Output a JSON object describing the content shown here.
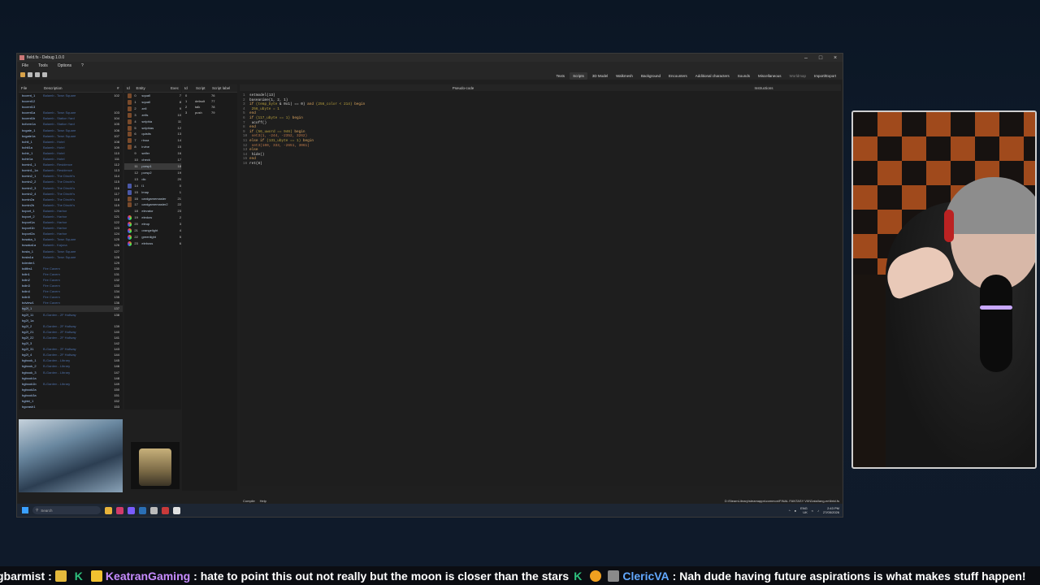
{
  "window": {
    "title": "field.fs - Debug 1.0.0",
    "menu": [
      "File",
      "Tools",
      "Options",
      "?"
    ],
    "controls": [
      "–",
      "□",
      "×"
    ]
  },
  "tabs": [
    {
      "label": "Texts",
      "active": false
    },
    {
      "label": "Scripts",
      "active": true
    },
    {
      "label": "3D Model",
      "active": false
    },
    {
      "label": "Walkmesh",
      "active": false
    },
    {
      "label": "Background",
      "active": false
    },
    {
      "label": "Encounters",
      "active": false
    },
    {
      "label": "Additional characters",
      "active": false
    },
    {
      "label": "Sounds",
      "active": false
    },
    {
      "label": "Miscellaneous",
      "active": false
    },
    {
      "label": "Worldmap",
      "active": false,
      "dim": true
    },
    {
      "label": "Import/Export",
      "active": false
    }
  ],
  "file_list": {
    "headers": [
      "File",
      "Description",
      "#"
    ],
    "rows": [
      [
        "bccent_1",
        "Balamb - Town Square",
        "102"
      ],
      [
        "bccent12",
        "",
        ""
      ],
      [
        "bccent13",
        "",
        ""
      ],
      [
        "bccent1a",
        "Balamb - Town Square",
        "103"
      ],
      [
        "bccent1b",
        "Balamb - Station Yard",
        "104"
      ],
      [
        "bcform1a",
        "Balamb - Station Yard",
        "105"
      ],
      [
        "bcgate_1",
        "Balamb - Town Square",
        "106"
      ],
      [
        "bcgate1a",
        "Balamb - Town Square",
        "107"
      ],
      [
        "bchtl_1",
        "Balamb - Hotel",
        "108"
      ],
      [
        "bchtl1a",
        "Balamb - Hotel",
        "109"
      ],
      [
        "bchtr_1",
        "Balamb - Hotel",
        "110"
      ],
      [
        "bchtr1a",
        "Balamb - Hotel",
        "111"
      ],
      [
        "bcmin1_1",
        "Balamb - Residence",
        "112"
      ],
      [
        "bcmin1_1a",
        "Balamb - Residence",
        "113"
      ],
      [
        "bcmin2_1",
        "Balamb - The Dincht's",
        "114"
      ],
      [
        "bcmin2_2",
        "Balamb - The Dincht's",
        "115"
      ],
      [
        "bcmin2_3",
        "Balamb - The Dincht's",
        "116"
      ],
      [
        "bcmin2_4",
        "Balamb - The Dincht's",
        "117"
      ],
      [
        "bcmin2a",
        "Balamb - The Dincht's",
        "118"
      ],
      [
        "bcmin2b",
        "Balamb - The Dincht's",
        "119"
      ],
      [
        "bcport_1",
        "Balamb - Harbor",
        "120"
      ],
      [
        "bcport_2",
        "Balamb - Harbor",
        "121"
      ],
      [
        "bcport1a",
        "Balamb - Harbor",
        "122"
      ],
      [
        "bcport1b",
        "Balamb - Harbor",
        "123"
      ],
      [
        "bcport2a",
        "Balamb - Harbor",
        "124"
      ],
      [
        "bcsaka_1",
        "Balamb - Town Square",
        "125"
      ],
      [
        "bcsaka1a",
        "Balamb - Kajona",
        "126"
      ],
      [
        "bcsta_1",
        "Balamb - Town Square",
        "127"
      ],
      [
        "bcsta1a",
        "Balamb - Town Square",
        "128"
      ],
      [
        "bdenter1",
        "",
        "129"
      ],
      [
        "bdifirs1",
        "Fire Cavern",
        "130"
      ],
      [
        "bdin1",
        "Fire Cavern",
        "131"
      ],
      [
        "bdin2",
        "Fire Cavern",
        "132"
      ],
      [
        "bdin3",
        "Fire Cavern",
        "133"
      ],
      [
        "bdin4",
        "Fire Cavern",
        "134"
      ],
      [
        "bdin5",
        "Fire Cavern",
        "135"
      ],
      [
        "bdview1",
        "Fire Cavern",
        "136"
      ],
      [
        "bg2f_1",
        "",
        "137"
      ],
      [
        "bg2f_11",
        "B-Garden - 2F Hallway",
        "138"
      ],
      [
        "bg2f_1a",
        "",
        ""
      ],
      [
        "bg2f_2",
        "B-Garden - 2F Hallway",
        "139"
      ],
      [
        "bg2f_21",
        "B-Garden - 2F Hallway",
        "140"
      ],
      [
        "bg2f_22",
        "B-Garden - 2F Hallway",
        "141"
      ],
      [
        "bg2f_3",
        "",
        "142"
      ],
      [
        "bg2f_31",
        "B-Garden - 2F Hallway",
        "143"
      ],
      [
        "bg2f_4",
        "B-Garden - 2F Hallway",
        "144"
      ],
      [
        "bgbook_1",
        "B-Garden - Library",
        "145"
      ],
      [
        "bgbook_2",
        "B-Garden - Library",
        "146"
      ],
      [
        "bgbook_3",
        "B-Garden - Library",
        "147"
      ],
      [
        "bgbook1a",
        "",
        "148"
      ],
      [
        "bgbook1b",
        "B-Garden - Library",
        "149"
      ],
      [
        "bgbook2a",
        "",
        "150"
      ],
      [
        "bgbook3a",
        "",
        "151"
      ],
      [
        "bgbkt_1",
        "",
        "152"
      ],
      [
        "bgcrash1",
        "",
        "153"
      ]
    ],
    "selected_index": 37
  },
  "entities": {
    "headers": [
      "Id",
      "Entity",
      "Exec"
    ],
    "rows": [
      {
        "id": "0",
        "name": "squall",
        "exec": "7",
        "icon": "char"
      },
      {
        "id": "1",
        "name": "squall",
        "exec": "8",
        "icon": "char"
      },
      {
        "id": "2",
        "name": "zell",
        "exec": "9",
        "icon": "char"
      },
      {
        "id": "3",
        "name": "zells",
        "exec": "10",
        "icon": "char"
      },
      {
        "id": "4",
        "name": "selphia",
        "exec": "11",
        "icon": "char"
      },
      {
        "id": "5",
        "name": "selphias",
        "exec": "12",
        "icon": "char"
      },
      {
        "id": "6",
        "name": "quistis",
        "exec": "13",
        "icon": "char"
      },
      {
        "id": "7",
        "name": "rinoa",
        "exec": "14",
        "icon": "char"
      },
      {
        "id": "8",
        "name": "irvine",
        "exec": "15",
        "icon": "char"
      },
      {
        "id": "9",
        "name": "seifer",
        "exec": "16",
        "icon": "none"
      },
      {
        "id": "10",
        "name": "check",
        "exec": "17",
        "icon": "none"
      },
      {
        "id": "11",
        "name": "porsp1",
        "exec": "18",
        "icon": "none"
      },
      {
        "id": "12",
        "name": "porsp2",
        "exec": "19",
        "icon": "none"
      },
      {
        "id": "13",
        "name": "dic",
        "exec": "20",
        "icon": "none"
      },
      {
        "id": "14",
        "name": "l1",
        "exec": "0",
        "icon": "blue"
      },
      {
        "id": "15",
        "name": "lmap",
        "exec": "1",
        "icon": "blue"
      },
      {
        "id": "16",
        "name": "cardgamemaster",
        "exec": "21",
        "icon": "char"
      },
      {
        "id": "17",
        "name": "cardgamemaster2",
        "exec": "22",
        "icon": "char"
      },
      {
        "id": "18",
        "name": "elevator",
        "exec": "23",
        "icon": "none"
      },
      {
        "id": "19",
        "name": "eledow",
        "exec": "2",
        "icon": "rgb"
      },
      {
        "id": "20",
        "name": "eleup",
        "exec": "3",
        "icon": "rgb"
      },
      {
        "id": "21",
        "name": "orangelight",
        "exec": "4",
        "icon": "rgb"
      },
      {
        "id": "22",
        "name": "greenlight",
        "exec": "5",
        "icon": "rgb"
      },
      {
        "id": "23",
        "name": "eleboss",
        "exec": "6",
        "icon": "rgb"
      }
    ],
    "selected_index": 11
  },
  "scripts": {
    "headers": [
      "Id",
      "Script",
      "Script label"
    ],
    "rows": [
      {
        "id": "0",
        "script": "",
        "label": "76"
      },
      {
        "id": "1",
        "script": "default",
        "label": "77"
      },
      {
        "id": "2",
        "script": "talk",
        "label": "78"
      },
      {
        "id": "3",
        "script": "push",
        "label": "79"
      }
    ]
  },
  "editor": {
    "header_pseudo": "Pseudo-code",
    "header_instr": "Instructions",
    "lines": [
      [
        {
          "t": "setmodel(13)",
          "c": "fn"
        }
      ],
      [
        {
          "t": "baseanime(1, 2, 1)",
          "c": "fn"
        }
      ],
      [
        {
          "t": "if ",
          "c": "kw"
        },
        {
          "t": "(temp_byte ",
          "c": "var"
        },
        {
          "t": "& 0x1) == 0) ",
          "c": "fn"
        },
        {
          "t": "and ",
          "c": "kw"
        },
        {
          "t": "(256_color < 214) ",
          "c": "var"
        },
        {
          "t": "begin",
          "c": "kw"
        }
      ],
      [
        {
          "t": "    256_ubyte = 1",
          "c": "var"
        }
      ],
      [
        {
          "t": "end",
          "c": "kw"
        }
      ],
      [
        {
          "t": "if ",
          "c": "kw"
        },
        {
          "t": "(117_ubyte == 1) ",
          "c": "var"
        },
        {
          "t": "begin",
          "c": "kw"
        }
      ],
      [
        {
          "t": "    ucoff()",
          "c": "fn"
        }
      ],
      [
        {
          "t": "end",
          "c": "kw"
        }
      ],
      [
        {
          "t": "if ",
          "c": "kw"
        },
        {
          "t": "(56_uword == 946) ",
          "c": "var"
        },
        {
          "t": "begin",
          "c": "kw"
        }
      ],
      [
        {
          "t": "    set3(1, -244, -2352, 3262)",
          "c": "num"
        }
      ],
      [
        {
          "t": "else if ",
          "c": "kw"
        },
        {
          "t": "(131_ubyte == 1) ",
          "c": "var"
        },
        {
          "t": "begin",
          "c": "kw"
        }
      ],
      [
        {
          "t": "    set3(100, 333, -2651, 3061)",
          "c": "num"
        }
      ],
      [
        {
          "t": "else",
          "c": "kw"
        }
      ],
      [
        {
          "t": "    hide()",
          "c": "fn"
        }
      ],
      [
        {
          "t": "end",
          "c": "kw"
        }
      ],
      [
        {
          "t": "ret(8)",
          "c": "fn"
        }
      ]
    ],
    "footer": [
      "Compile",
      "Help"
    ]
  },
  "status_path": "D:\\SteamLibrary\\steamapps\\common\\FINAL FANTASY VIII\\Data\\lang-en\\field.fs",
  "taskbar": {
    "search_placeholder": "Search",
    "lang": "ENG",
    "region": "UK",
    "time": "2:43 PM",
    "date": "27/05/2026"
  },
  "chat": [
    {
      "user": "gbarmist",
      "text": ":"
    },
    {
      "user": "KeatranGaming",
      "text": ": hate to point this out not really but the moon is closer than the stars"
    },
    {
      "user": "ClericVA",
      "text": ": Nah dude having future aspirations is what makes stuff happen!"
    }
  ],
  "colors": {
    "accent_tab": "#333333",
    "chat_user_purple": "#c78cff",
    "chat_user_blue": "#62a8ff",
    "chat_k": "#2ec27e"
  }
}
